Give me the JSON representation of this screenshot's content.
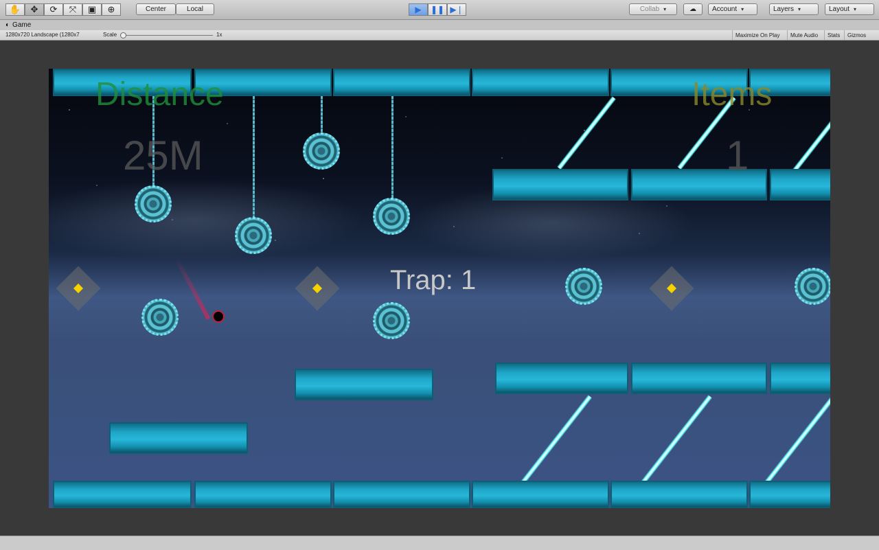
{
  "toolbar": {
    "tools": [
      "hand-icon",
      "move-icon",
      "rotate-icon",
      "scale-icon",
      "rect-icon",
      "transform-icon"
    ],
    "pivot_center": "Center",
    "pivot_local": "Local",
    "collab": "Collab",
    "account": "Account",
    "layers": "Layers",
    "layout": "Layout"
  },
  "game_tab": {
    "title": "Game",
    "resolution": "1280x720 Landscape (1280x7",
    "scale_label": "Scale",
    "scale_value": "1x",
    "maximize": "Maximize On Play",
    "mute": "Mute Audio",
    "stats": "Stats",
    "gizmos": "Gizmos"
  },
  "hud": {
    "distance_label": "Distance",
    "distance_value": "25M",
    "items_label": "Items",
    "items_value": "1",
    "trap_text": "Trap: 1"
  },
  "colors": {
    "distance": "#1f8f3a",
    "items": "#8a8a2a",
    "hud_value": "#5a5a5a",
    "trap": "#c8c8c8",
    "bar": "#1ea6c8"
  }
}
